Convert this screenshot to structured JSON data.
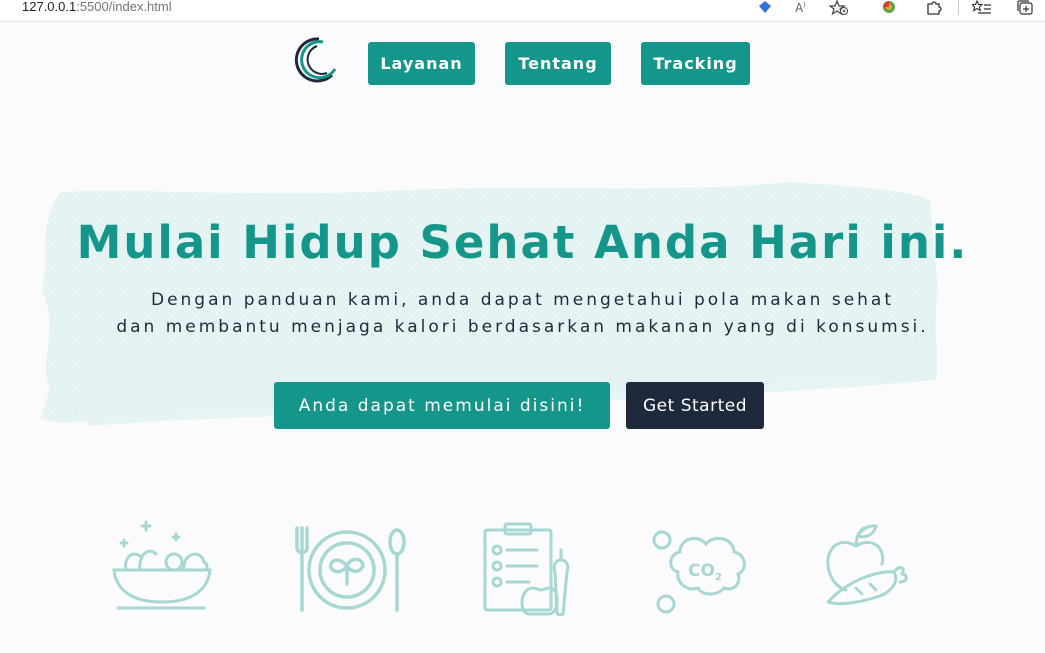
{
  "browser": {
    "url_host": "127.0.0.1",
    "url_rest": ":5500/index.html"
  },
  "nav": {
    "items": [
      {
        "label": "Layanan"
      },
      {
        "label": "Tentang"
      },
      {
        "label": "Tracking"
      }
    ]
  },
  "hero": {
    "title": "Mulai Hidup Sehat Anda Hari ini.",
    "subtitle_line1": "Dengan panduan kami, anda dapat mengetahui pola makan sehat",
    "subtitle_line2": "dan membantu menjaga kalori berdasarkan makanan yang di konsumsi.",
    "cta_primary": "Anda dapat memulai disini!",
    "cta_secondary": "Get Started"
  },
  "features": {
    "icons": [
      "salad-bowl-icon",
      "plate-cutlery-icon",
      "diet-checklist-icon",
      "co2-icon",
      "apple-carrot-icon"
    ],
    "co2_label": "CO",
    "co2_sub": "2"
  },
  "colors": {
    "accent": "#14968a",
    "dark": "#1e293b",
    "icon_tint": "#a7d7d3",
    "brush": "#e3f3f2",
    "background": "#fbfbfd"
  }
}
